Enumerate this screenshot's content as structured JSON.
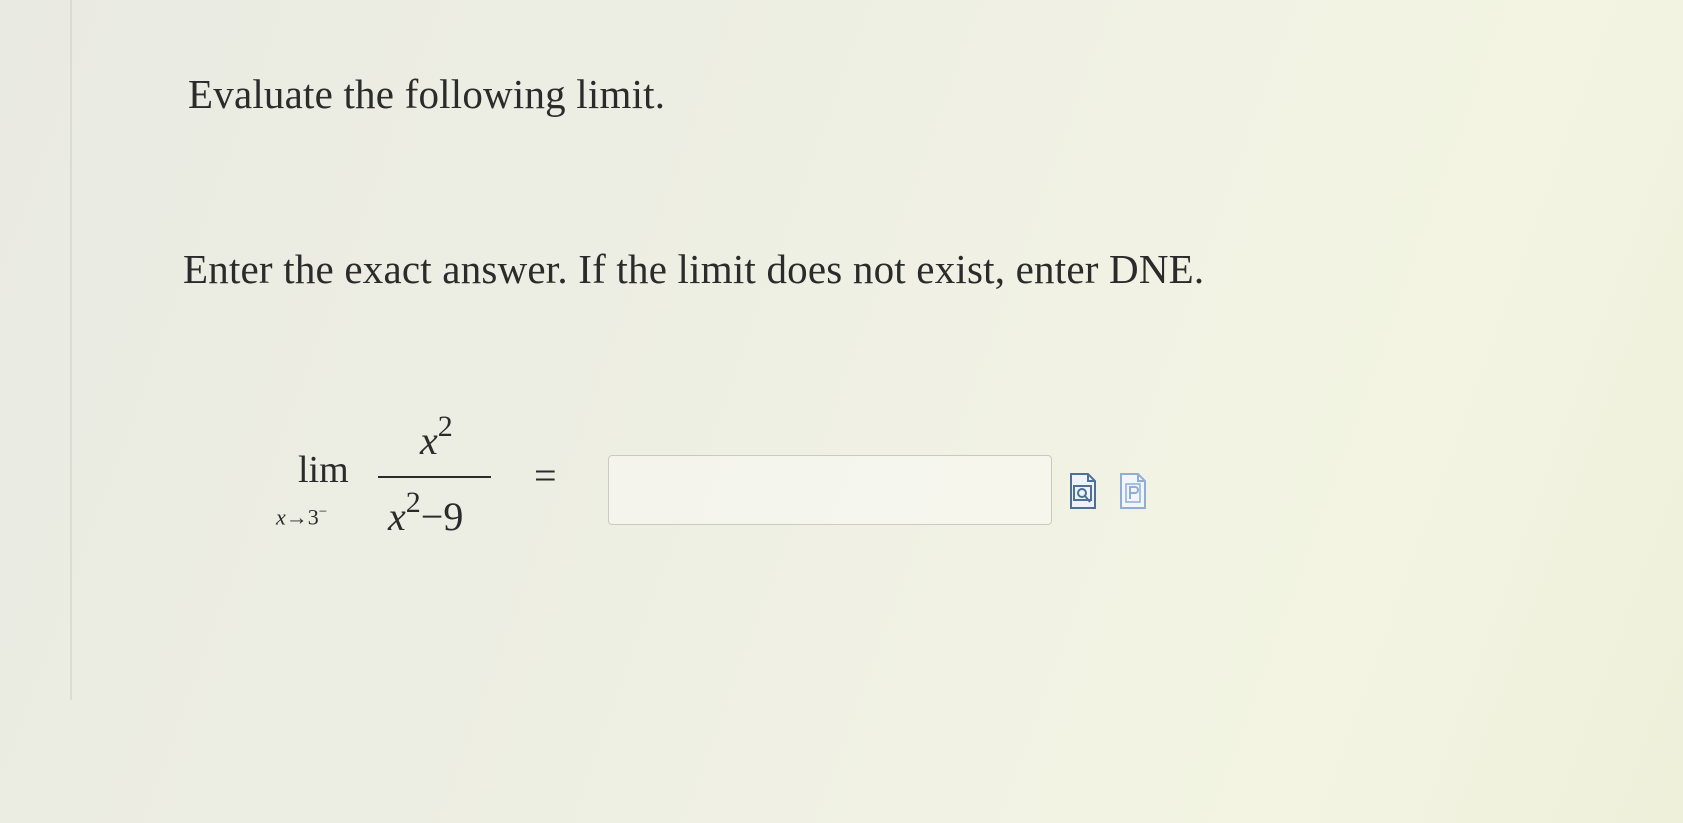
{
  "prompt": {
    "instruction": "Evaluate the following limit.",
    "answer_rule": "Enter the exact answer. If the limit does not exist, enter DNE."
  },
  "problem": {
    "lim_word": "lim",
    "lim_variable": "x",
    "lim_arrow": "→",
    "lim_target": "3",
    "lim_side": "−",
    "numerator_variable": "x",
    "numerator_exponent": "2",
    "denominator_variable": "x",
    "denominator_exponent": "2",
    "denominator_rest": "−9",
    "equals": "="
  },
  "answer": {
    "value": "",
    "placeholder": ""
  },
  "tools": {
    "preview_icon": "preview-icon",
    "help_icon": "help-icon",
    "accent": "#5b8bc9"
  }
}
